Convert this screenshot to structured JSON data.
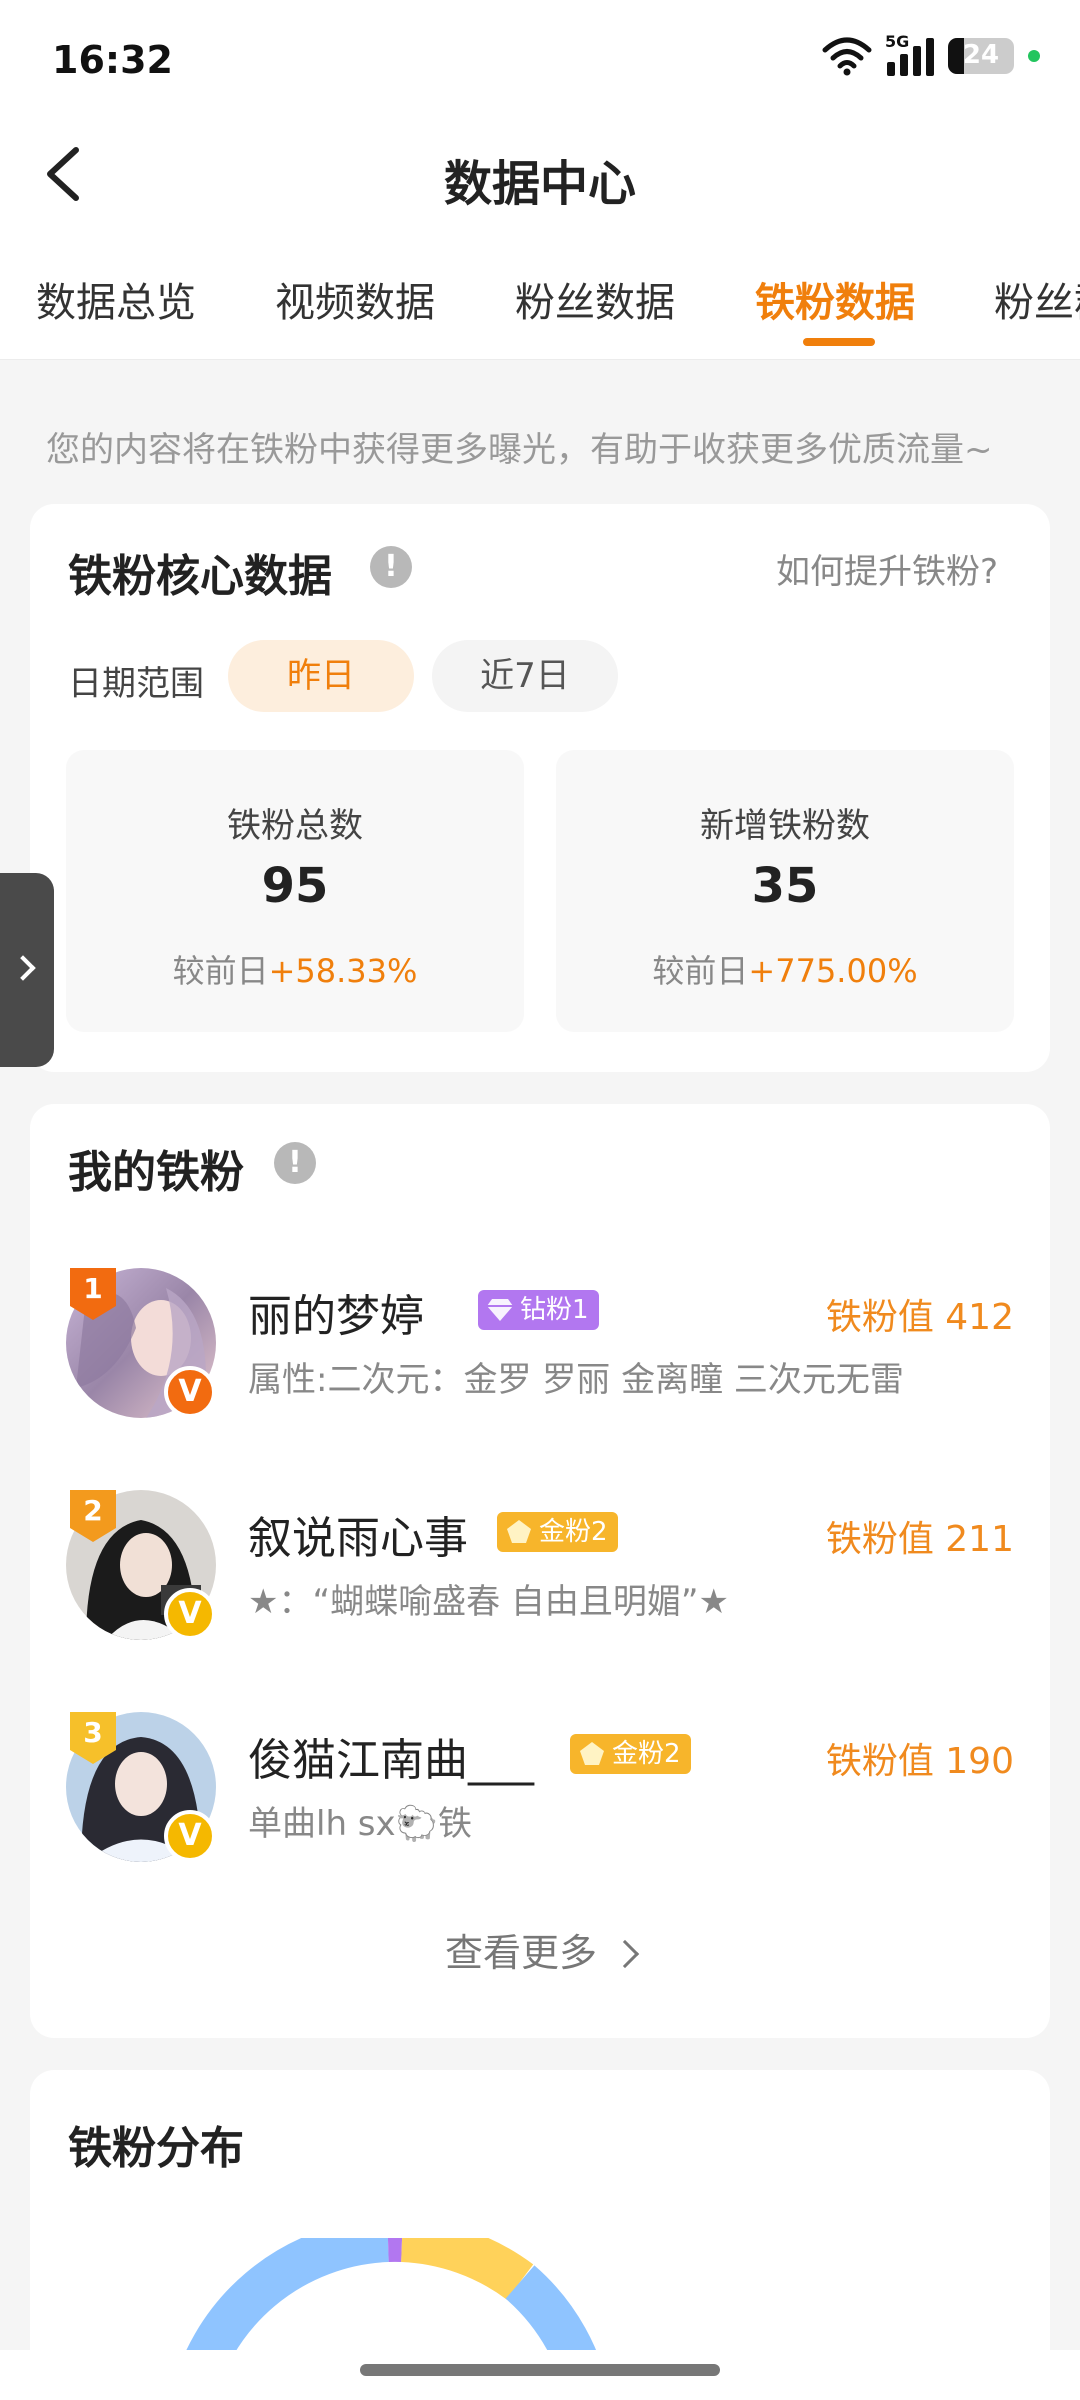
{
  "status_bar": {
    "time": "16:32",
    "network": "5G",
    "battery_level": "24",
    "battery_fraction": 0.24,
    "icons": [
      "wifi-icon",
      "signal-icon",
      "battery-icon",
      "charging-dot"
    ]
  },
  "header": {
    "title": "数据中心",
    "back_icon": "chevron-left-icon"
  },
  "tabs": [
    {
      "label": "数据总览",
      "active": false
    },
    {
      "label": "视频数据",
      "active": false
    },
    {
      "label": "粉丝数据",
      "active": false
    },
    {
      "label": "铁粉数据",
      "active": true
    },
    {
      "label": "粉丝群",
      "active": false
    }
  ],
  "tip": "您的内容将在铁粉中获得更多曝光，有助于收获更多优质流量~",
  "core": {
    "title": "铁粉核心数据",
    "info_icon": "!",
    "help_link": "如何提升铁粉?",
    "range_label": "日期范围",
    "range_options": [
      "昨日",
      "近7日"
    ],
    "selected_range": "昨日",
    "stats": [
      {
        "label": "铁粉总数",
        "value": "95",
        "change_prefix": "较前日",
        "change": "+58.33%"
      },
      {
        "label": "新增铁粉数",
        "value": "35",
        "change_prefix": "较前日",
        "change": "+775.00%"
      }
    ]
  },
  "my_fans": {
    "title": "我的铁粉",
    "info_icon": "!",
    "fans": [
      {
        "rank": "1",
        "name": "丽的梦婷",
        "badge": "钻粉1",
        "badge_type": "diamond",
        "value_label": "铁粉值",
        "value": "412",
        "desc": "属性:二次元：金罗 罗丽 金离瞳 三次元无雷",
        "verify": "V",
        "verify_color": "#f26b10"
      },
      {
        "rank": "2",
        "name": "叙说雨心事",
        "badge": "金粉2",
        "badge_type": "gold",
        "value_label": "铁粉值",
        "value": "211",
        "desc": "★：“蝴蝶喻盛春 自由且明媚”★",
        "verify": "V",
        "verify_color": "#f5b800"
      },
      {
        "rank": "3",
        "name": "俊猫江南曲___",
        "badge": "金粉2",
        "badge_type": "gold",
        "value_label": "铁粉值",
        "value": "190",
        "desc": "单曲lh sx🐑铁",
        "verify": "V",
        "verify_color": "#f5b800"
      }
    ],
    "see_more": "查看更多"
  },
  "distribution": {
    "title": "铁粉分布"
  },
  "colors": {
    "accent": "#f07f0c",
    "diamond_badge": "#b277f0",
    "gold_badge": "#f7b52b",
    "rank1": "#f26b10",
    "rank2": "#f39a1d",
    "rank3": "#f6c02a",
    "chart_blue": "#8fc4ff",
    "chart_yellow": "#ffd25a",
    "chart_purple": "#b277f0"
  }
}
